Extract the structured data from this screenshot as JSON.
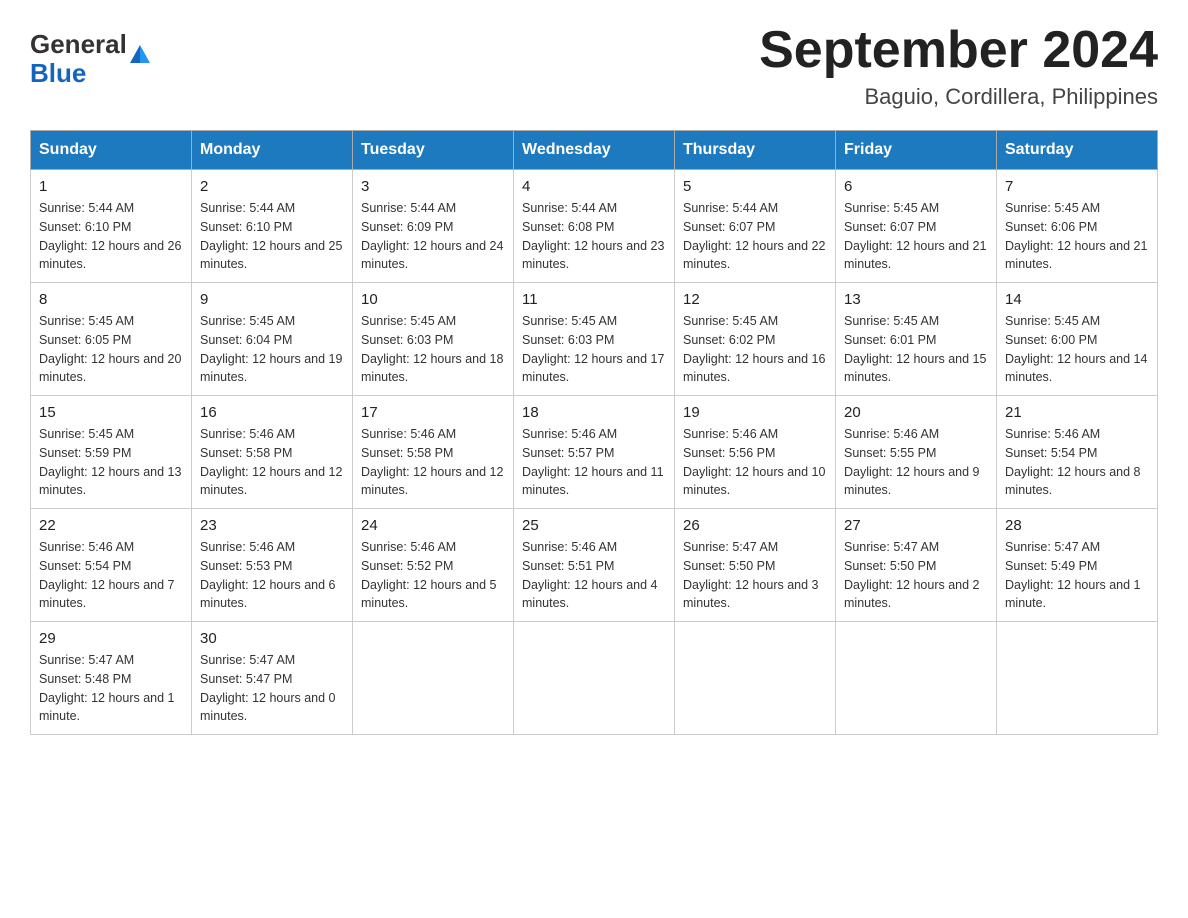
{
  "header": {
    "logo_general": "General",
    "logo_blue": "Blue",
    "title": "September 2024",
    "subtitle": "Baguio, Cordillera, Philippines"
  },
  "days_of_week": [
    "Sunday",
    "Monday",
    "Tuesday",
    "Wednesday",
    "Thursday",
    "Friday",
    "Saturday"
  ],
  "weeks": [
    [
      {
        "day": "1",
        "sunrise": "5:44 AM",
        "sunset": "6:10 PM",
        "daylight": "12 hours and 26 minutes."
      },
      {
        "day": "2",
        "sunrise": "5:44 AM",
        "sunset": "6:10 PM",
        "daylight": "12 hours and 25 minutes."
      },
      {
        "day": "3",
        "sunrise": "5:44 AM",
        "sunset": "6:09 PM",
        "daylight": "12 hours and 24 minutes."
      },
      {
        "day": "4",
        "sunrise": "5:44 AM",
        "sunset": "6:08 PM",
        "daylight": "12 hours and 23 minutes."
      },
      {
        "day": "5",
        "sunrise": "5:44 AM",
        "sunset": "6:07 PM",
        "daylight": "12 hours and 22 minutes."
      },
      {
        "day": "6",
        "sunrise": "5:45 AM",
        "sunset": "6:07 PM",
        "daylight": "12 hours and 21 minutes."
      },
      {
        "day": "7",
        "sunrise": "5:45 AM",
        "sunset": "6:06 PM",
        "daylight": "12 hours and 21 minutes."
      }
    ],
    [
      {
        "day": "8",
        "sunrise": "5:45 AM",
        "sunset": "6:05 PM",
        "daylight": "12 hours and 20 minutes."
      },
      {
        "day": "9",
        "sunrise": "5:45 AM",
        "sunset": "6:04 PM",
        "daylight": "12 hours and 19 minutes."
      },
      {
        "day": "10",
        "sunrise": "5:45 AM",
        "sunset": "6:03 PM",
        "daylight": "12 hours and 18 minutes."
      },
      {
        "day": "11",
        "sunrise": "5:45 AM",
        "sunset": "6:03 PM",
        "daylight": "12 hours and 17 minutes."
      },
      {
        "day": "12",
        "sunrise": "5:45 AM",
        "sunset": "6:02 PM",
        "daylight": "12 hours and 16 minutes."
      },
      {
        "day": "13",
        "sunrise": "5:45 AM",
        "sunset": "6:01 PM",
        "daylight": "12 hours and 15 minutes."
      },
      {
        "day": "14",
        "sunrise": "5:45 AM",
        "sunset": "6:00 PM",
        "daylight": "12 hours and 14 minutes."
      }
    ],
    [
      {
        "day": "15",
        "sunrise": "5:45 AM",
        "sunset": "5:59 PM",
        "daylight": "12 hours and 13 minutes."
      },
      {
        "day": "16",
        "sunrise": "5:46 AM",
        "sunset": "5:58 PM",
        "daylight": "12 hours and 12 minutes."
      },
      {
        "day": "17",
        "sunrise": "5:46 AM",
        "sunset": "5:58 PM",
        "daylight": "12 hours and 12 minutes."
      },
      {
        "day": "18",
        "sunrise": "5:46 AM",
        "sunset": "5:57 PM",
        "daylight": "12 hours and 11 minutes."
      },
      {
        "day": "19",
        "sunrise": "5:46 AM",
        "sunset": "5:56 PM",
        "daylight": "12 hours and 10 minutes."
      },
      {
        "day": "20",
        "sunrise": "5:46 AM",
        "sunset": "5:55 PM",
        "daylight": "12 hours and 9 minutes."
      },
      {
        "day": "21",
        "sunrise": "5:46 AM",
        "sunset": "5:54 PM",
        "daylight": "12 hours and 8 minutes."
      }
    ],
    [
      {
        "day": "22",
        "sunrise": "5:46 AM",
        "sunset": "5:54 PM",
        "daylight": "12 hours and 7 minutes."
      },
      {
        "day": "23",
        "sunrise": "5:46 AM",
        "sunset": "5:53 PM",
        "daylight": "12 hours and 6 minutes."
      },
      {
        "day": "24",
        "sunrise": "5:46 AM",
        "sunset": "5:52 PM",
        "daylight": "12 hours and 5 minutes."
      },
      {
        "day": "25",
        "sunrise": "5:46 AM",
        "sunset": "5:51 PM",
        "daylight": "12 hours and 4 minutes."
      },
      {
        "day": "26",
        "sunrise": "5:47 AM",
        "sunset": "5:50 PM",
        "daylight": "12 hours and 3 minutes."
      },
      {
        "day": "27",
        "sunrise": "5:47 AM",
        "sunset": "5:50 PM",
        "daylight": "12 hours and 2 minutes."
      },
      {
        "day": "28",
        "sunrise": "5:47 AM",
        "sunset": "5:49 PM",
        "daylight": "12 hours and 1 minute."
      }
    ],
    [
      {
        "day": "29",
        "sunrise": "5:47 AM",
        "sunset": "5:48 PM",
        "daylight": "12 hours and 1 minute."
      },
      {
        "day": "30",
        "sunrise": "5:47 AM",
        "sunset": "5:47 PM",
        "daylight": "12 hours and 0 minutes."
      },
      null,
      null,
      null,
      null,
      null
    ]
  ]
}
